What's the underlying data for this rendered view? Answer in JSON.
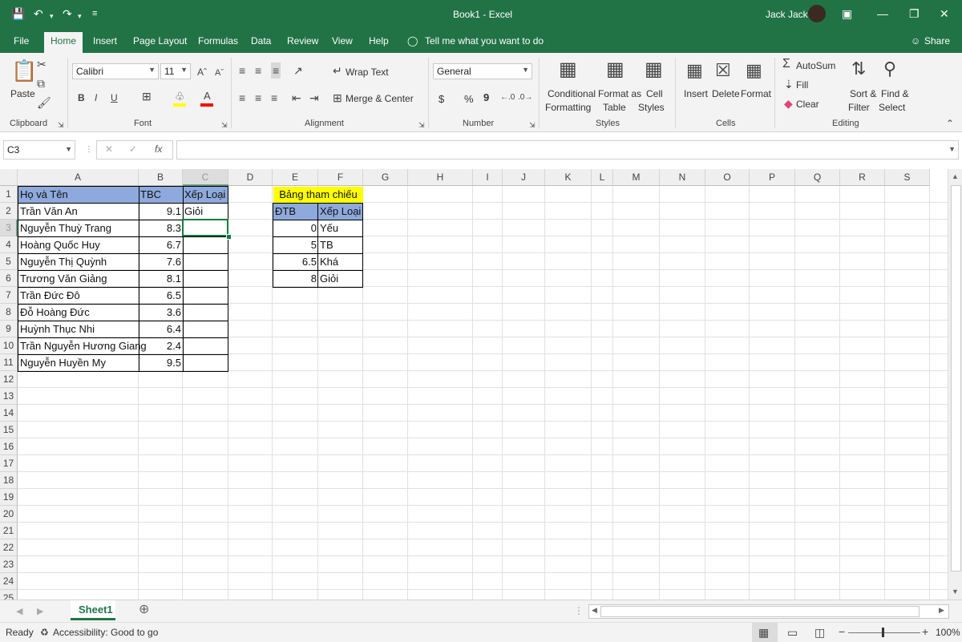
{
  "titlebar": {
    "doc_title": "Book1  -  Excel",
    "user_name": "Jack Jack",
    "save_icon": "save-icon",
    "undo_icon": "undo-icon",
    "redo_icon": "redo-icon"
  },
  "tabs": [
    "File",
    "Home",
    "Insert",
    "Page Layout",
    "Formulas",
    "Data",
    "Review",
    "View",
    "Help"
  ],
  "tell_me": "Tell me what you want to do",
  "share": "Share",
  "ribbon": {
    "clipboard": {
      "label": "Clipboard",
      "paste": "Paste"
    },
    "font": {
      "label": "Font",
      "name": "Calibri",
      "size": "11"
    },
    "alignment": {
      "label": "Alignment",
      "wrap": "Wrap Text",
      "merge": "Merge & Center"
    },
    "number": {
      "label": "Number",
      "format": "General",
      "currency": "$",
      "percent": "%",
      "comma": "9"
    },
    "styles": {
      "label": "Styles",
      "cond1": "Conditional",
      "cond2": "Formatting",
      "fmt1": "Format as",
      "fmt2": "Table",
      "cell1": "Cell",
      "cell2": "Styles"
    },
    "cells": {
      "label": "Cells",
      "insert": "Insert",
      "delete": "Delete",
      "format": "Format"
    },
    "editing": {
      "label": "Editing",
      "autosum": "AutoSum",
      "fill": "Fill",
      "clear": "Clear",
      "sort1": "Sort &",
      "sort2": "Filter",
      "find1": "Find &",
      "find2": "Select"
    }
  },
  "formula_bar": {
    "name_box": "C3",
    "fx": "fx",
    "value": ""
  },
  "columns": [
    "A",
    "B",
    "C",
    "D",
    "E",
    "F",
    "G",
    "H",
    "I",
    "J",
    "K",
    "L",
    "M",
    "N",
    "O",
    "P",
    "Q",
    "R",
    "S"
  ],
  "rows": [
    "1",
    "2",
    "3",
    "4",
    "5",
    "6",
    "7",
    "8",
    "9",
    "10",
    "11",
    "12",
    "13",
    "14",
    "15",
    "16",
    "17",
    "18",
    "19",
    "20",
    "21",
    "22",
    "23",
    "24",
    "25"
  ],
  "table": {
    "headers": [
      "Họ và Tên",
      "TBC",
      "Xếp Loại"
    ],
    "rows": [
      [
        "Trần Văn An",
        "9.1",
        "Giỏi"
      ],
      [
        "Nguyễn Thuỳ Trang",
        "8.3",
        ""
      ],
      [
        "Hoàng Quốc Huy",
        "6.7",
        ""
      ],
      [
        "Nguyễn Thị Quỳnh",
        "7.6",
        ""
      ],
      [
        "Trương Văn Giảng",
        "8.1",
        ""
      ],
      [
        "Trần Đức Đô",
        "6.5",
        ""
      ],
      [
        "Đỗ Hoàng Đức",
        "3.6",
        ""
      ],
      [
        "Huỳnh Thục Nhi",
        "6.4",
        ""
      ],
      [
        "Trần Nguyễn Hương Giang",
        "2.4",
        ""
      ],
      [
        "Nguyễn Huyền My",
        "9.5",
        ""
      ]
    ]
  },
  "lookup": {
    "title": "Bảng tham chiếu",
    "headers": [
      "ĐTB",
      "Xếp Loại"
    ],
    "rows": [
      [
        "0",
        "Yếu"
      ],
      [
        "5",
        "TB"
      ],
      [
        "6.5",
        "Khá"
      ],
      [
        "8",
        "Giỏi"
      ]
    ]
  },
  "colors": {
    "excel_green": "#217346",
    "header_fill": "#8ea9db",
    "lookup_title_fill": "#ffff00",
    "selection": "#107c41"
  },
  "sheet_tab": "Sheet1",
  "status": {
    "ready": "Ready",
    "accessibility": "Accessibility: Good to go",
    "zoom": "100%"
  }
}
